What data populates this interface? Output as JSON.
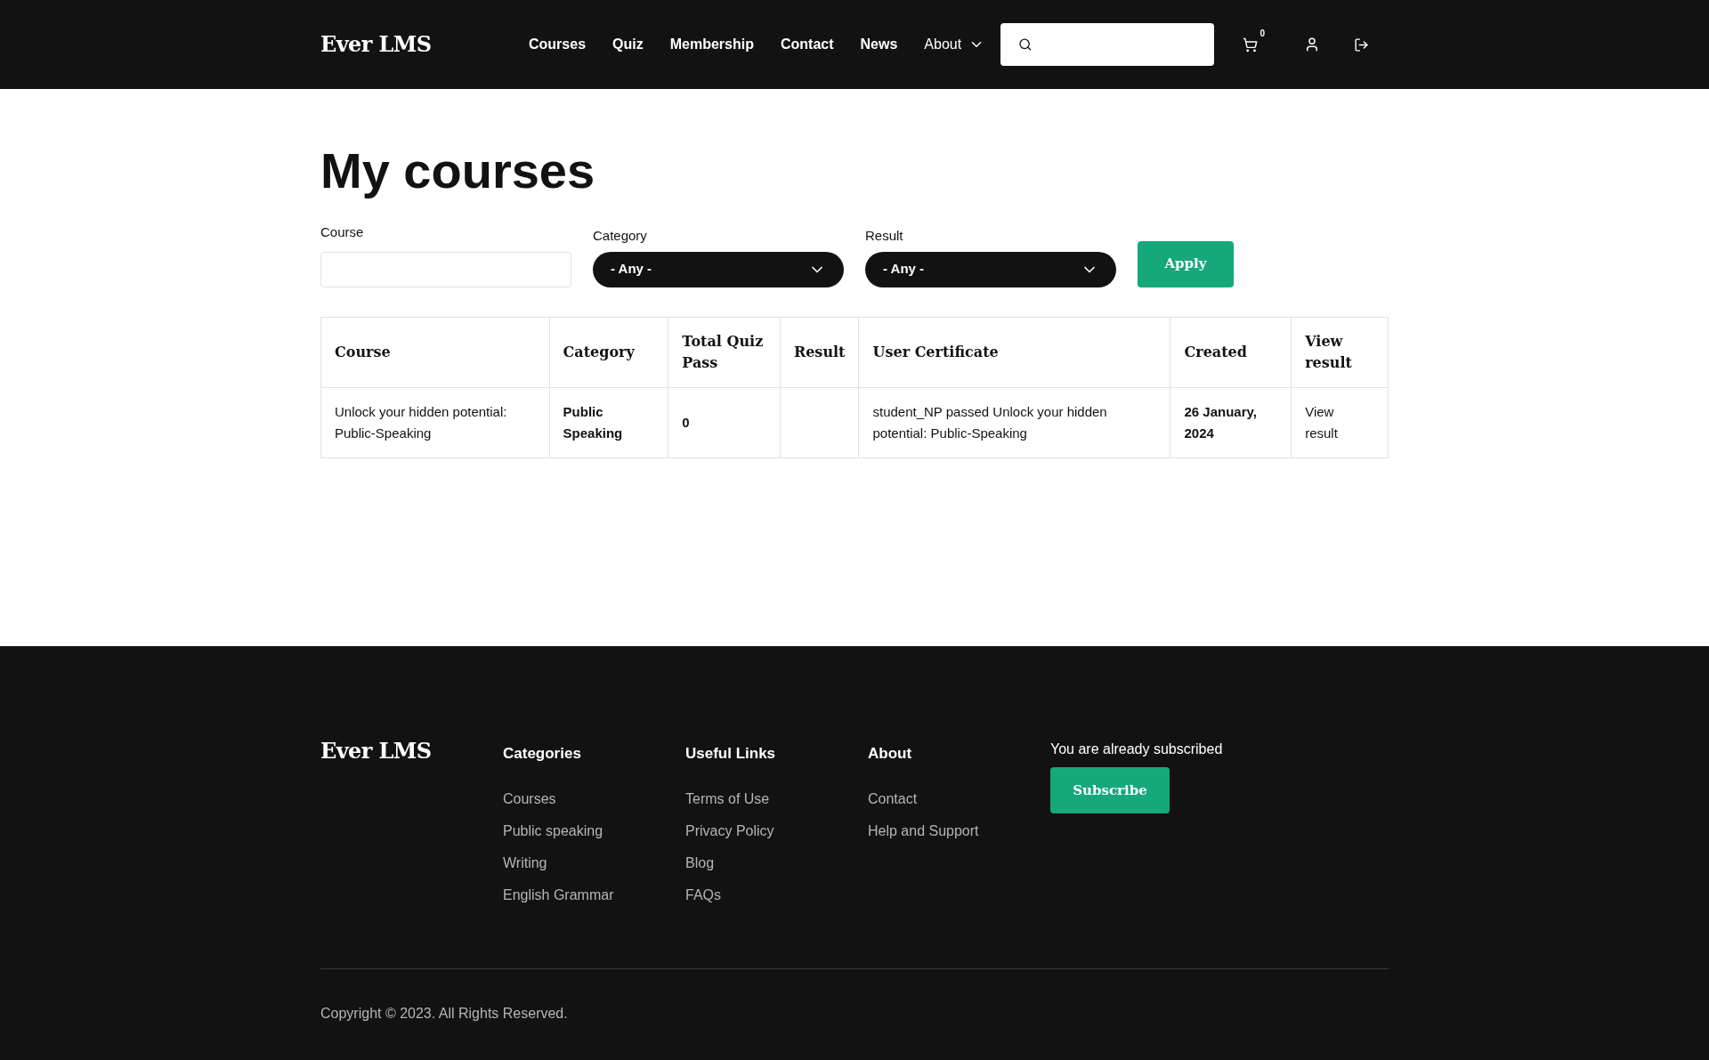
{
  "header": {
    "logo": "Ever LMS",
    "nav": [
      {
        "label": "Courses",
        "dropdown": false
      },
      {
        "label": "Quiz",
        "dropdown": false
      },
      {
        "label": "Membership",
        "dropdown": false
      },
      {
        "label": "Contact",
        "dropdown": false
      },
      {
        "label": "News",
        "dropdown": false
      },
      {
        "label": "About",
        "dropdown": true
      }
    ],
    "cart_count": "0"
  },
  "page": {
    "title": "My courses"
  },
  "filters": [
    {
      "kind": "text",
      "label": "Course"
    },
    {
      "kind": "select",
      "label": "Category",
      "value": "- Any -"
    },
    {
      "kind": "select",
      "label": "Result",
      "value": "- Any -"
    }
  ],
  "apply_button": "Apply",
  "table": {
    "columns": [
      "Course",
      "Category",
      "Total Quiz Pass",
      "Result",
      "User Certificate",
      "Created",
      "View result"
    ],
    "rows": [
      [
        "Unlock your hidden potential: Public-Speaking",
        "Public Speaking",
        "0",
        "",
        "student_NP passed Unlock your hidden potential: Public-Speaking",
        "26 January, 2024",
        "View result"
      ]
    ]
  },
  "footer": {
    "logo": "Ever LMS",
    "columns": [
      {
        "title": "Categories",
        "links": [
          "Courses",
          "Public speaking",
          "Writing",
          "English Grammar"
        ]
      },
      {
        "title": "Useful Links",
        "links": [
          "Terms of Use",
          "Privacy Policy",
          "Blog",
          "FAQs"
        ]
      },
      {
        "title": "About",
        "links": [
          "Contact",
          "Help and Support"
        ]
      }
    ],
    "subscribe_note": "You are already subscribed",
    "subscribe_button": "Subscribe",
    "copyright": "Copyright © 2023. All Rights Reserved."
  }
}
